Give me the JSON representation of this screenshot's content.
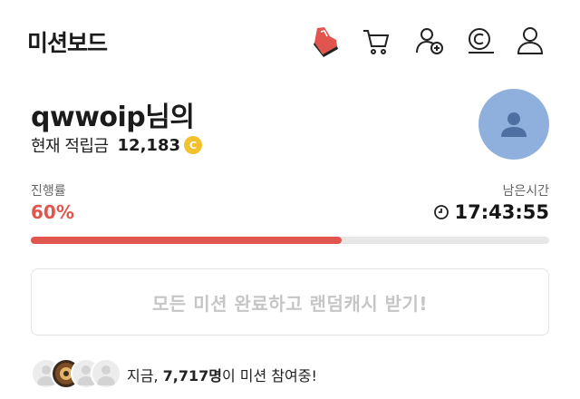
{
  "header": {
    "title": "미션보드",
    "icons": [
      "shoe-icon",
      "cart-icon",
      "add-user-icon",
      "coin-icon",
      "profile-icon"
    ]
  },
  "user": {
    "name": "qwwoip님의",
    "points_label": "현재 적립금",
    "points_value": "12,183",
    "coin_symbol": "C"
  },
  "progress": {
    "label": "진행률",
    "value_text": "60%",
    "fraction": 0.6
  },
  "remaining": {
    "label": "남은시간",
    "value": "17:43:55"
  },
  "reward_button": {
    "label": "모든 미션 완료하고 랜덤캐시 받기!"
  },
  "participants": {
    "prefix": "지금, ",
    "count": "7,717명",
    "suffix": "이 미션 참여중!"
  },
  "colors": {
    "accent": "#e0564f",
    "avatar": "#8fb0dc",
    "coin": "#f3c130",
    "disabled_text": "#c6c6c6"
  }
}
